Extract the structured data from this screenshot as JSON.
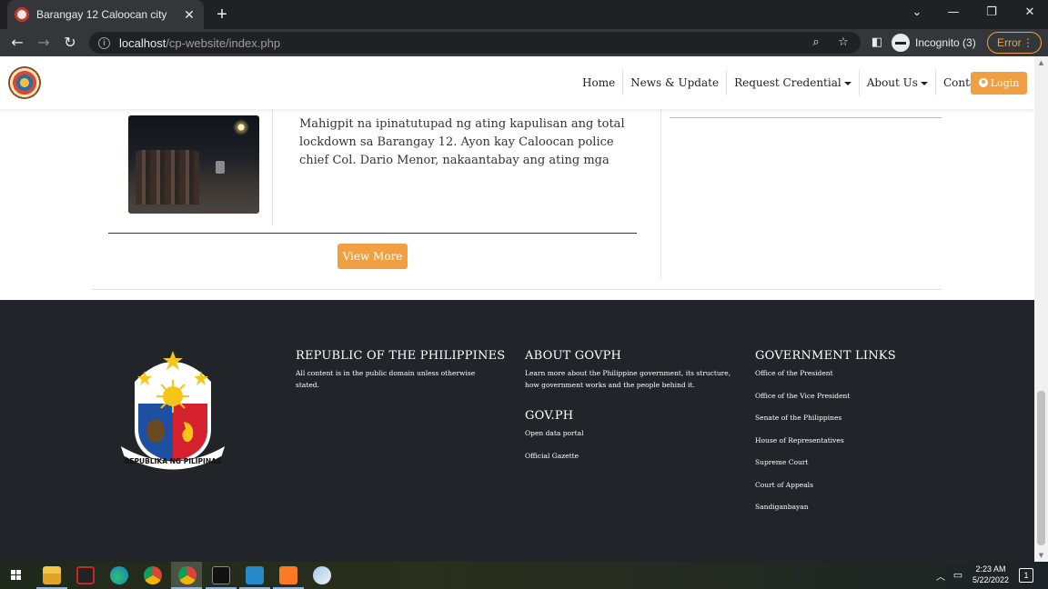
{
  "browser": {
    "tab_title": "Barangay 12 Caloocan city",
    "tab_close": "✕",
    "new_tab": "+",
    "url_host": "localhost",
    "url_path": "/cp-website/index.php",
    "incognito_label": "Incognito (3)",
    "error_label": "Error",
    "controls": {
      "minimize": "—",
      "restore": "❐",
      "close": "✕",
      "dropdown": "⌄"
    }
  },
  "site_nav": {
    "items": [
      {
        "label": "Home"
      },
      {
        "label": "News & Update"
      },
      {
        "label": "Request Credential"
      },
      {
        "label": "About Us"
      },
      {
        "label": "Contact Us"
      }
    ],
    "login_label": "Login"
  },
  "news": {
    "excerpt": "Mahigpit na ipinatutupad ng ating kapulisan ang total lockdown sa Barangay 12. Ayon kay Caloocan police chief Col. Dario Menor, nakaantabay ang ating mga",
    "view_more_label": "View More"
  },
  "footer": {
    "republic": {
      "heading": "REPUBLIC OF THE PHILIPPINES",
      "text": "All content is in the public domain unless otherwise stated."
    },
    "about": {
      "heading": "ABOUT GOVPH",
      "text": "Learn more about the Philippine government, its structure, how government works and the people behind it."
    },
    "govph": {
      "heading": "GOV.PH",
      "links": [
        "Open data portal",
        "Official Gazette"
      ]
    },
    "gov_links": {
      "heading": "GOVERNMENT LINKS",
      "links": [
        "Office of the President",
        "Office of the Vice President",
        "Senate of the Philippines",
        "House of Representatives",
        "Supreme Court",
        "Court of Appeals",
        "Sandiganbayan"
      ]
    },
    "seal_text": "REPUBLIKA NG PILIPINAS"
  },
  "taskbar": {
    "time": "2:23 AM",
    "date": "5/22/2022",
    "notification_count": "1",
    "apps": [
      "file-explorer",
      "game-launcher",
      "edge",
      "chrome",
      "chrome-incognito",
      "terminal",
      "vscode",
      "xampp",
      "other-app"
    ]
  },
  "colors": {
    "accent": "#f0a042",
    "footer_bg": "#212529",
    "chrome_dark": "#202124",
    "chrome_toolbar": "#35363a"
  }
}
